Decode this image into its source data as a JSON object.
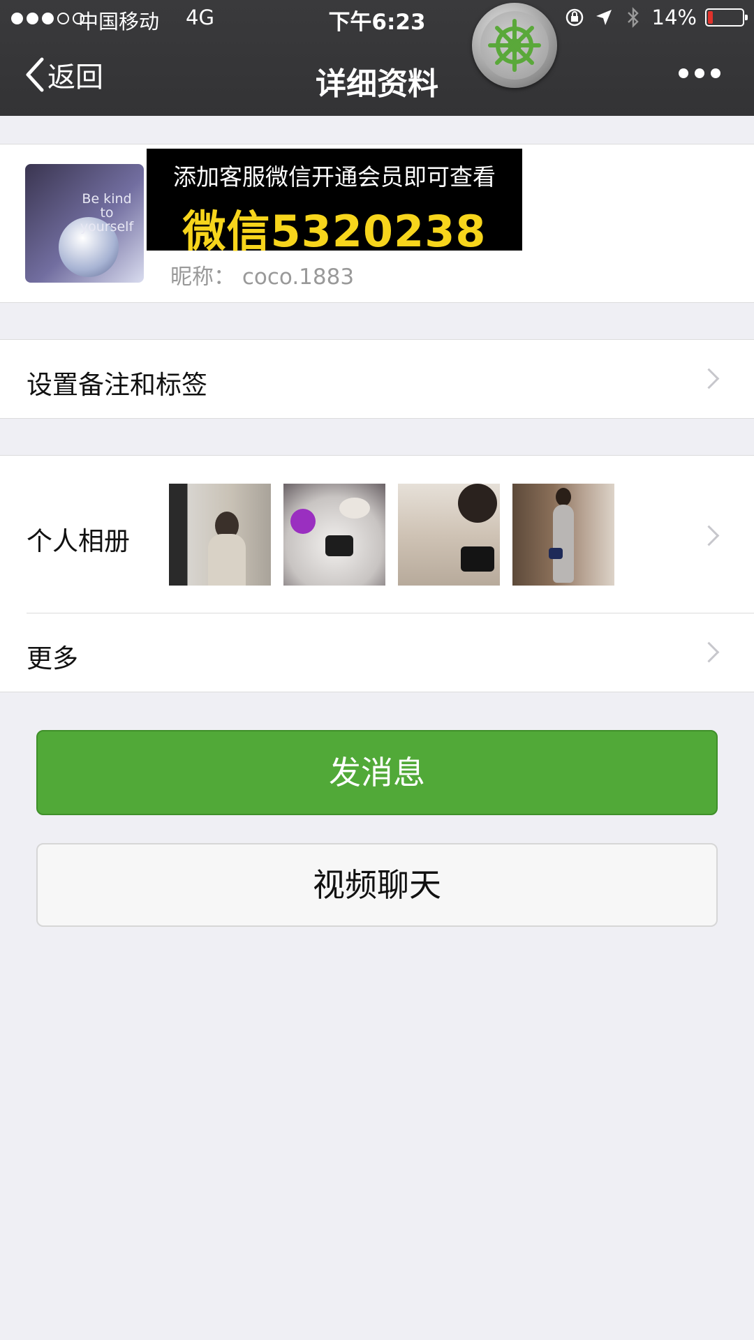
{
  "status_bar": {
    "carrier": "中国移动",
    "network": "4G",
    "time": "下午6:23",
    "battery_percent": "14%",
    "signal_strength": 3,
    "signal_max": 5,
    "battery_level": 0.14,
    "icons": [
      "orientation-lock-icon",
      "location-arrow-icon",
      "bluetooth-icon",
      "battery-icon"
    ]
  },
  "nav": {
    "back_label": "返回",
    "title": "详细资料"
  },
  "profile": {
    "avatar_text": "Be kind to yourself",
    "ad_line1": "添加客服微信开通会员即可查看",
    "ad_line2": "微信5320238",
    "nickname": "昵称： coco.1883"
  },
  "rows": {
    "remark_label": "设置备注和标签",
    "album_label": "个人相册",
    "more_label": "更多"
  },
  "buttons": {
    "send_message": "发消息",
    "video_chat": "视频聊天"
  },
  "colors": {
    "accent_green": "#51a938",
    "nav_bg": "#333335",
    "page_bg": "#efeff4",
    "ad_yellow": "#f7d51c",
    "battery_low": "#e0322b"
  }
}
